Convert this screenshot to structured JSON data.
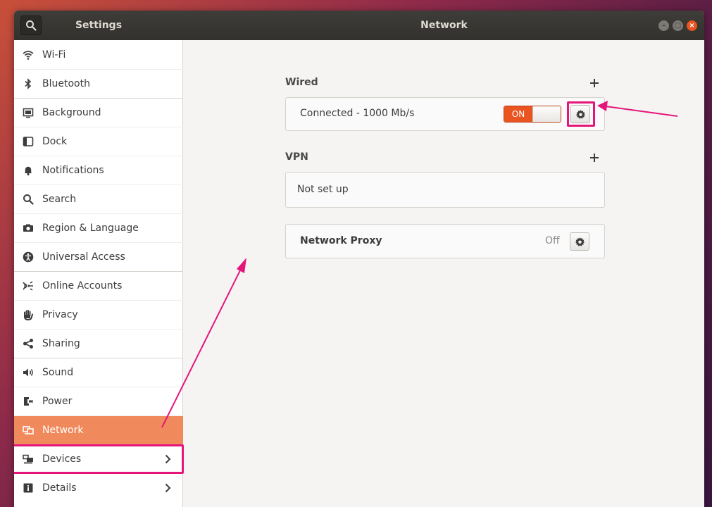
{
  "titlebar": {
    "app_title": "Settings",
    "page_title": "Network"
  },
  "sidebar": {
    "items": [
      {
        "label": "Wi-Fi",
        "icon": "wifi-icon"
      },
      {
        "label": "Bluetooth",
        "icon": "bluetooth-icon"
      },
      {
        "label": "Background",
        "icon": "background-icon"
      },
      {
        "label": "Dock",
        "icon": "dock-icon"
      },
      {
        "label": "Notifications",
        "icon": "bell-icon"
      },
      {
        "label": "Search",
        "icon": "search-icon"
      },
      {
        "label": "Region & Language",
        "icon": "camera-icon"
      },
      {
        "label": "Universal Access",
        "icon": "accessibility-icon"
      },
      {
        "label": "Online Accounts",
        "icon": "online-accounts-icon"
      },
      {
        "label": "Privacy",
        "icon": "hand-icon"
      },
      {
        "label": "Sharing",
        "icon": "share-icon"
      },
      {
        "label": "Sound",
        "icon": "speaker-icon"
      },
      {
        "label": "Power",
        "icon": "power-plug-icon"
      },
      {
        "label": "Network",
        "icon": "network-icon",
        "active": true
      },
      {
        "label": "Devices",
        "icon": "devices-icon",
        "chevron": true
      },
      {
        "label": "Details",
        "icon": "info-icon",
        "chevron": true
      }
    ]
  },
  "main": {
    "wired": {
      "section_label": "Wired",
      "status": "Connected - 1000 Mb/s",
      "switch_label": "ON"
    },
    "vpn": {
      "section_label": "VPN",
      "status": "Not set up"
    },
    "proxy": {
      "label": "Network Proxy",
      "status": "Off"
    }
  },
  "colors": {
    "accent": "#e95420",
    "active_item": "#f08a5d",
    "highlight": "#e5157a"
  }
}
